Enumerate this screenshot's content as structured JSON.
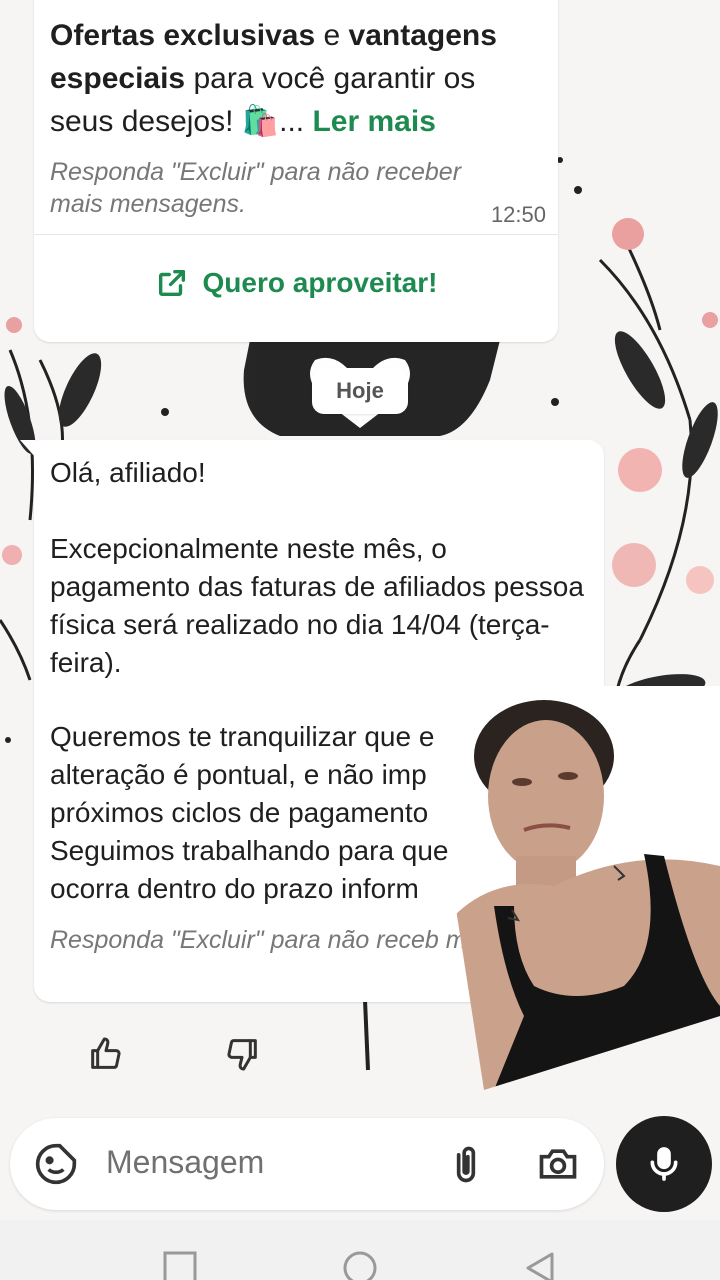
{
  "message1": {
    "bold1": "Ofertas exclusivas",
    "mid1": " e ",
    "bold2": "vantagens especiais",
    "rest": " para você garantir os seus desejos! 🛍️...",
    "read_more": "Ler mais",
    "note": "Responda \"Excluir\" para não receber mais mensagens.",
    "time": "12:50",
    "action_label": "Quero aproveitar!"
  },
  "date_chip": "Hoje",
  "message2": {
    "greeting": "Olá, afiliado!",
    "paragraph1": "Excepcionalmente neste mês, o pagamento das faturas de afiliados pessoa física será realizado no dia 14/04 (terça-feira).",
    "paragraph2": "Queremos te tranquilizar que e\nalteração é pontual, e não imp\npróximos ciclos de pagamento\nSeguimos trabalhando para que\nocorra dentro do prazo inform",
    "note": "Responda \"Excluir\" para não receb\nmensagens."
  },
  "composer": {
    "placeholder": "Mensagem"
  },
  "icons": {
    "sticker": "sticker-icon",
    "attach": "paperclip-icon",
    "camera": "camera-icon",
    "mic": "microphone-icon",
    "like": "thumbs-up-icon",
    "dislike": "thumbs-down-icon",
    "external": "external-link-icon"
  },
  "colors": {
    "accent_green": "#1d8a4f",
    "mic_bg": "#1f1f1f"
  }
}
